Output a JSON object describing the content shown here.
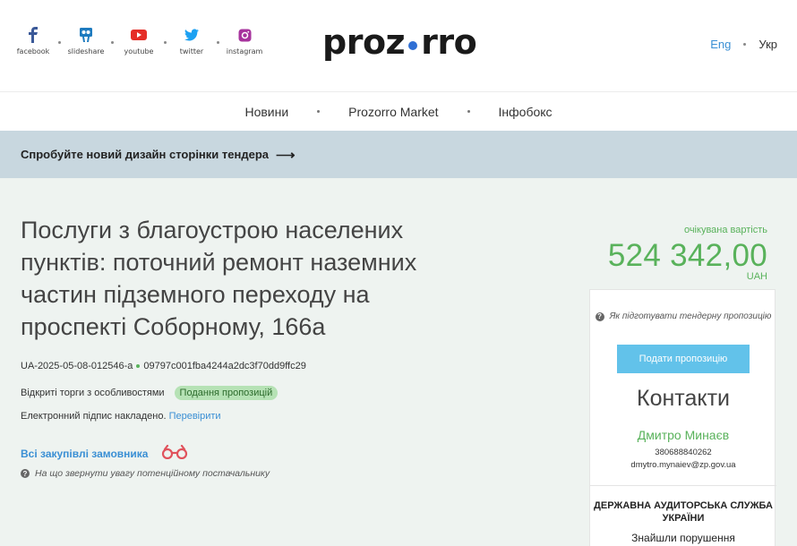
{
  "header": {
    "socials": [
      {
        "label": "facebook",
        "icon": "facebook-icon",
        "color": "#3b5998"
      },
      {
        "label": "slideshare",
        "icon": "slideshare-icon",
        "color": "#1e7bbf"
      },
      {
        "label": "youtube",
        "icon": "youtube-icon",
        "color": "#e52d27"
      },
      {
        "label": "twitter",
        "icon": "twitter-icon",
        "color": "#1da1f2"
      },
      {
        "label": "instagram",
        "icon": "instagram-icon",
        "color": "#a7339d"
      }
    ],
    "logo_left": "proz",
    "logo_right": "rro",
    "logo_dot_color": "#2f6fd4",
    "lang_en": "Eng",
    "lang_uk": "Укр"
  },
  "nav": {
    "items": [
      "Новини",
      "Prozorro Market",
      "Інфобокс"
    ]
  },
  "banner": {
    "text": "Спробуйте новий дизайн сторінки тендера",
    "arrow": "⟶"
  },
  "tender": {
    "title": "Послуги з благоустрою населених пунктів: поточний ремонт наземних частин підземного переходу на проспекті Соборному, 166а",
    "id": "UA-2025-05-08-012546-a",
    "hash": "09797c001fba4244a2dc3f70dd9ffc29",
    "procedure": "Відкриті торги з особливостями",
    "status": "Подання пропозицій",
    "signature_text": "Електронний підпис накладено.",
    "signature_check": "Перевірити",
    "all_purchases": "Всі закупівлі замовника",
    "attention": "На що звернути увагу потенційному постачальнику"
  },
  "price": {
    "label": "очікувана вартість",
    "amount": "524 342,00",
    "currency": "UAH"
  },
  "card": {
    "how_prepare": "Як підготувати тендерну пропозицію",
    "submit": "Подати пропозицію",
    "contacts_title": "Контакти",
    "contact_name": "Дмитро Минаєв",
    "contact_phone": "380688840262",
    "contact_email": "dmytro.mynaiev@zp.gov.ua",
    "audit_title": "ДЕРЖАВНА АУДИТОРСЬКА СЛУЖБА УКРАЇНИ",
    "found_violations": "Знайшли порушення"
  },
  "colors": {
    "accent_green": "#59b25b",
    "link_blue": "#3a8fd4",
    "banner_bg": "#c8d7df",
    "main_bg": "#eef3f0",
    "button_bg": "#62c2ea"
  }
}
